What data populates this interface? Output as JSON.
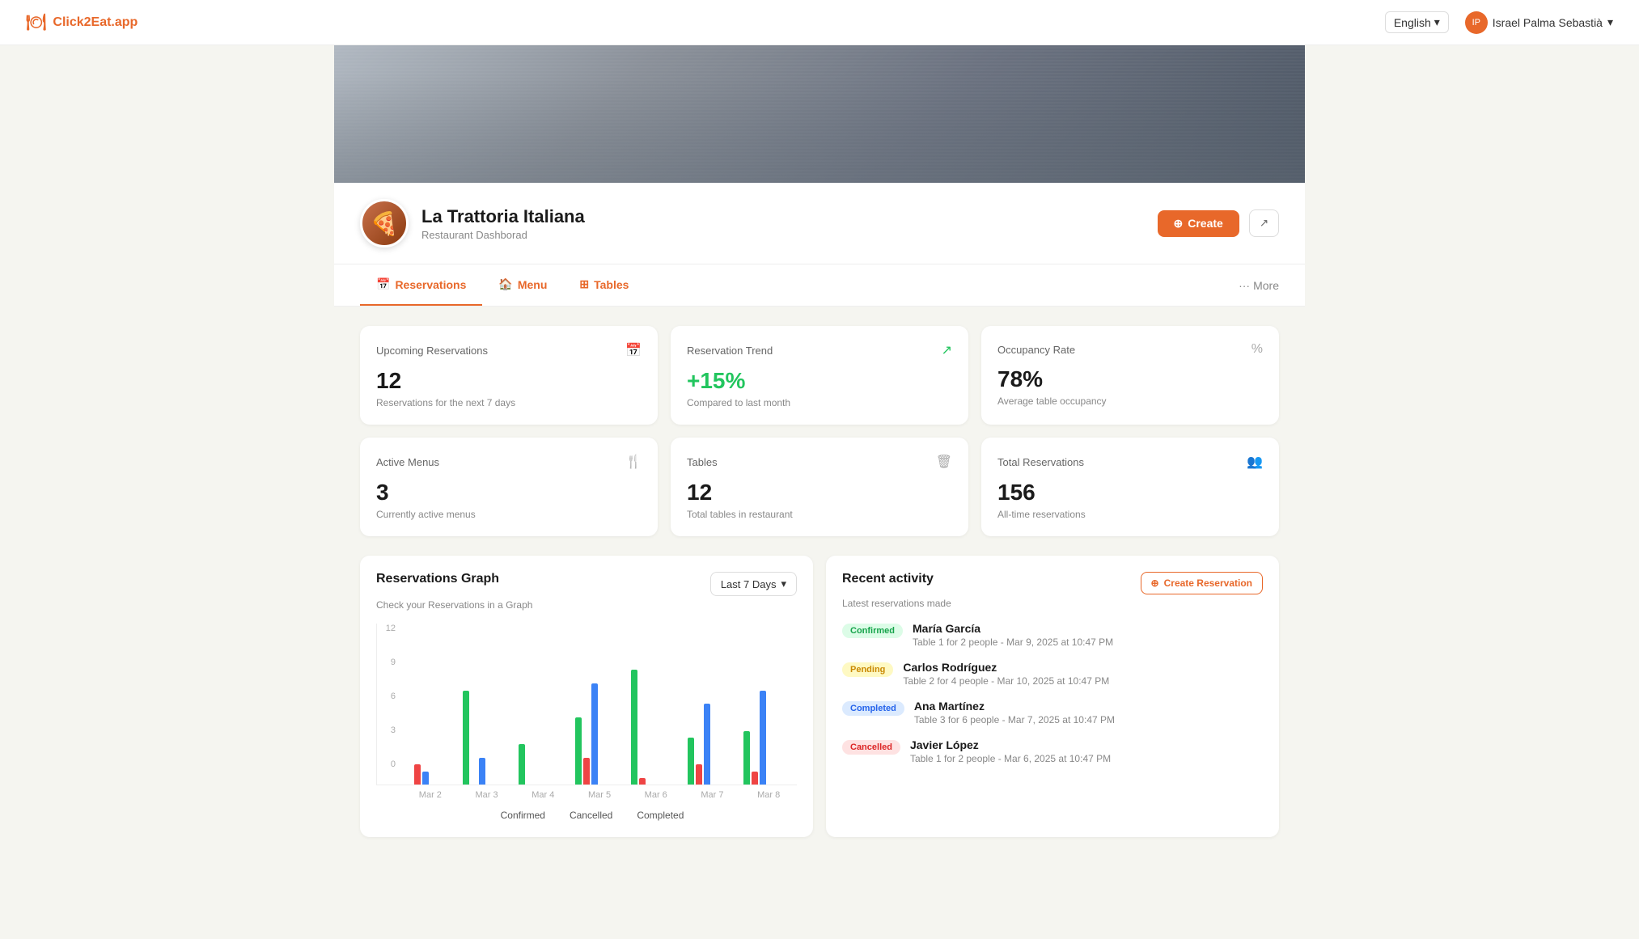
{
  "navbar": {
    "brand": "Click2Eat.app",
    "brand_icon": "🍽",
    "lang_label": "English",
    "lang_arrow": "▾",
    "user_name": "Israel Palma Sebastià",
    "user_arrow": "▾",
    "user_initials": "IP"
  },
  "restaurant": {
    "logo_emoji": "🍕",
    "name": "La Trattoria Italiana",
    "subtitle": "Restaurant Dashborad",
    "btn_create": "Create",
    "btn_external_icon": "↗"
  },
  "nav_tabs": {
    "tabs": [
      {
        "id": "reservations",
        "label": "Reservations",
        "icon": "📅",
        "active": true
      },
      {
        "id": "menu",
        "label": "Menu",
        "icon": "🏠"
      },
      {
        "id": "tables",
        "label": "Tables",
        "icon": "⊞"
      }
    ],
    "more_dots": "···",
    "more_label": "More"
  },
  "stats": [
    {
      "id": "upcoming",
      "label": "Upcoming Reservations",
      "icon": "📅",
      "value": "12",
      "desc": "Reservations for the next 7 days"
    },
    {
      "id": "trend",
      "label": "Reservation Trend",
      "icon": "📈",
      "value": "+15%",
      "value_class": "green",
      "desc": "Compared to last month"
    },
    {
      "id": "occupancy",
      "label": "Occupancy Rate",
      "icon": "%",
      "value": "78%",
      "desc": "Average table occupancy"
    },
    {
      "id": "menus",
      "label": "Active Menus",
      "icon": "🍴",
      "value": "3",
      "desc": "Currently active menus"
    },
    {
      "id": "tables",
      "label": "Tables",
      "icon": "🗑",
      "value": "12",
      "desc": "Total tables in restaurant"
    },
    {
      "id": "total",
      "label": "Total Reservations",
      "icon": "👥",
      "value": "156",
      "desc": "All-time reservations"
    }
  ],
  "graph": {
    "title": "Reservations Graph",
    "subtitle": "Check your Reservations in a Graph",
    "period_label": "Last 7 Days",
    "y_labels": [
      "12",
      "9",
      "6",
      "3",
      "0"
    ],
    "x_labels": [
      "Mar 2",
      "Mar 3",
      "Mar 4",
      "Mar 5",
      "Mar 6",
      "Mar 7",
      "Mar 8"
    ],
    "bars": [
      {
        "date": "Mar 2",
        "confirmed": 0,
        "cancelled": 15,
        "completed": 10
      },
      {
        "date": "Mar 3",
        "confirmed": 70,
        "cancelled": 0,
        "completed": 20
      },
      {
        "date": "Mar 4",
        "confirmed": 30,
        "cancelled": 0,
        "completed": 0
      },
      {
        "date": "Mar 5",
        "confirmed": 50,
        "cancelled": 20,
        "completed": 75
      },
      {
        "date": "Mar 6",
        "confirmed": 85,
        "cancelled": 5,
        "completed": 0
      },
      {
        "date": "Mar 7",
        "confirmed": 35,
        "cancelled": 15,
        "completed": 60
      },
      {
        "date": "Mar 8",
        "confirmed": 40,
        "cancelled": 10,
        "completed": 70
      }
    ],
    "legend": [
      {
        "label": "Confirmed",
        "class": "confirmed"
      },
      {
        "label": "Cancelled",
        "class": "cancelled"
      },
      {
        "label": "Completed",
        "class": "completed"
      }
    ]
  },
  "activity": {
    "title": "Recent activity",
    "subtitle": "Latest reservations made",
    "btn_create": "Create Reservation",
    "items": [
      {
        "status": "Confirmed",
        "status_class": "badge-confirmed",
        "name": "María García",
        "detail": "Table 1 for 2 people - Mar 9, 2025 at 10:47 PM"
      },
      {
        "status": "Pending",
        "status_class": "badge-pending",
        "name": "Carlos Rodríguez",
        "detail": "Table 2 for 4 people - Mar 10, 2025 at 10:47 PM"
      },
      {
        "status": "Completed",
        "status_class": "badge-completed",
        "name": "Ana Martínez",
        "detail": "Table 3 for 6 people - Mar 7, 2025 at 10:47 PM"
      },
      {
        "status": "Cancelled",
        "status_class": "badge-cancelled",
        "name": "Javier López",
        "detail": "Table 1 for 2 people - Mar 6, 2025 at 10:47 PM"
      }
    ]
  }
}
